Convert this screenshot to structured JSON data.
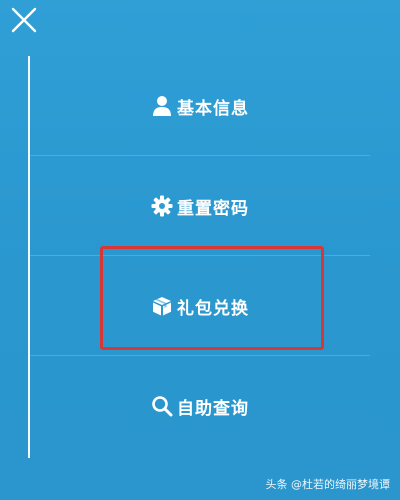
{
  "header": {
    "close_icon": "close-icon"
  },
  "menu": {
    "items": [
      {
        "label": "基本信息",
        "icon": "user-icon"
      },
      {
        "label": "重置密码",
        "icon": "gear-icon"
      },
      {
        "label": "礼包兑换",
        "icon": "box-icon",
        "highlighted": true
      },
      {
        "label": "自助查询",
        "icon": "search-icon"
      }
    ]
  },
  "colors": {
    "background": "#2f9fd6",
    "highlight_border": "#d93636",
    "text": "#ffffff"
  },
  "watermark": {
    "text": "头条 @杜若的绮丽梦境谭"
  }
}
